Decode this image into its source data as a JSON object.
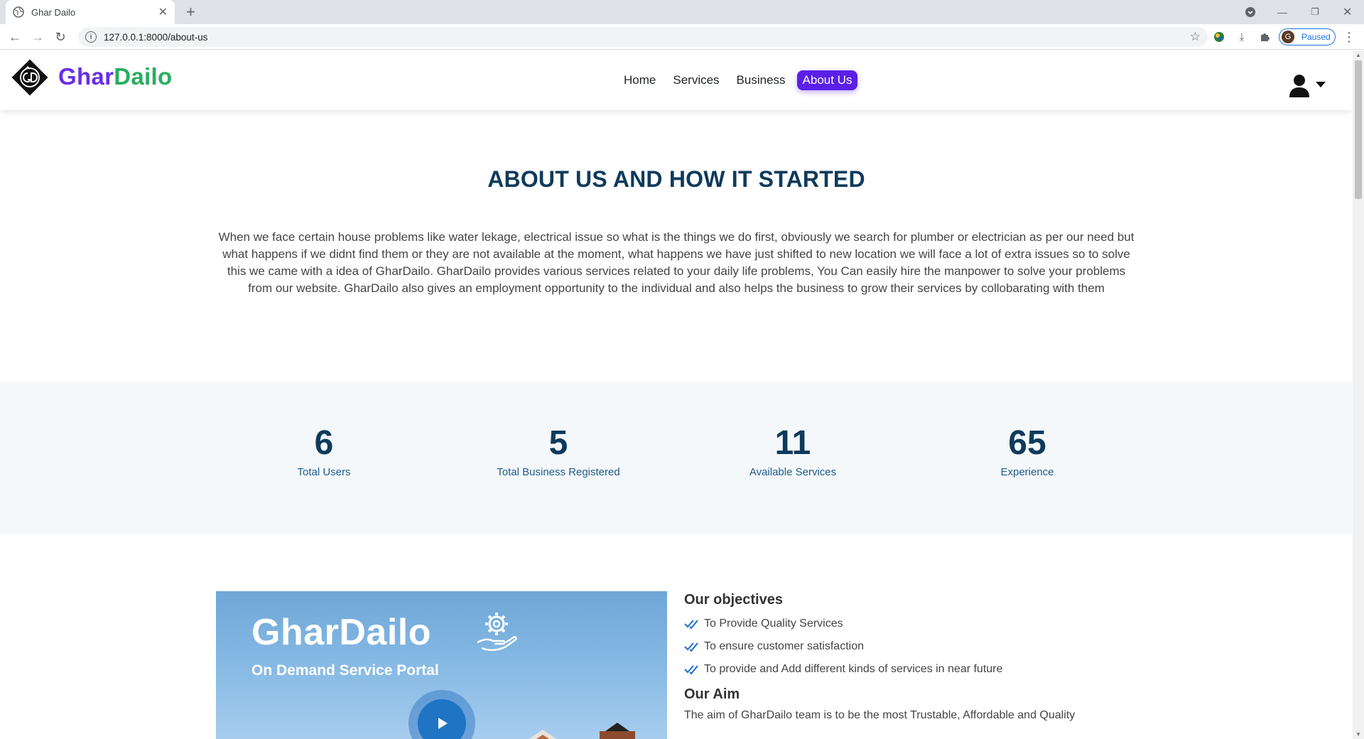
{
  "browser": {
    "tab_title": "Ghar Dailo",
    "new_tab": "+",
    "url": "127.0.0.1:8000/about-us",
    "profile_initial": "G",
    "profile_status": "Paused"
  },
  "header": {
    "brand_part1": "Ghar",
    "brand_part2": "Dailo",
    "nav": [
      "Home",
      "Services",
      "Business",
      "About Us"
    ],
    "active_nav": "About Us"
  },
  "about": {
    "heading": "ABOUT US AND HOW IT STARTED",
    "text": "When we face certain house problems like water lekage, electrical issue so what is the things we do first, obviously we search for plumber or electrician as per our need but what happens if we didnt find them or they are not available at the moment, what happens we have just shifted to new location we will face a lot of extra issues so to solve this we came with a idea of GharDailo. GharDailo provides various services related to your daily life problems, You Can easily hire the manpower to solve your problems from our website. GharDailo also gives an employment opportunity to the individual and also helps the business to grow their services by collobarating with them"
  },
  "stats": [
    {
      "value": "6",
      "label": "Total Users"
    },
    {
      "value": "5",
      "label": "Total Business Registered"
    },
    {
      "value": "11",
      "label": "Available Services"
    },
    {
      "value": "65",
      "label": "Experience"
    }
  ],
  "video": {
    "title": "GharDailo",
    "subtitle": "On Demand Service Portal"
  },
  "objectives": {
    "heading": "Our objectives",
    "items": [
      "To Provide Quality Services",
      "To ensure customer satisfaction",
      "To provide and Add different kinds of services in near future"
    ],
    "aim_heading": "Our Aim",
    "aim_text": "The aim of GharDailo team is to be the most Trustable, Affordable and Quality"
  },
  "colors": {
    "brand_purple": "#6a2ee8",
    "brand_green": "#27ae60",
    "active_nav_bg": "#5b1fe8",
    "heading_navy": "#0e3b5c"
  }
}
